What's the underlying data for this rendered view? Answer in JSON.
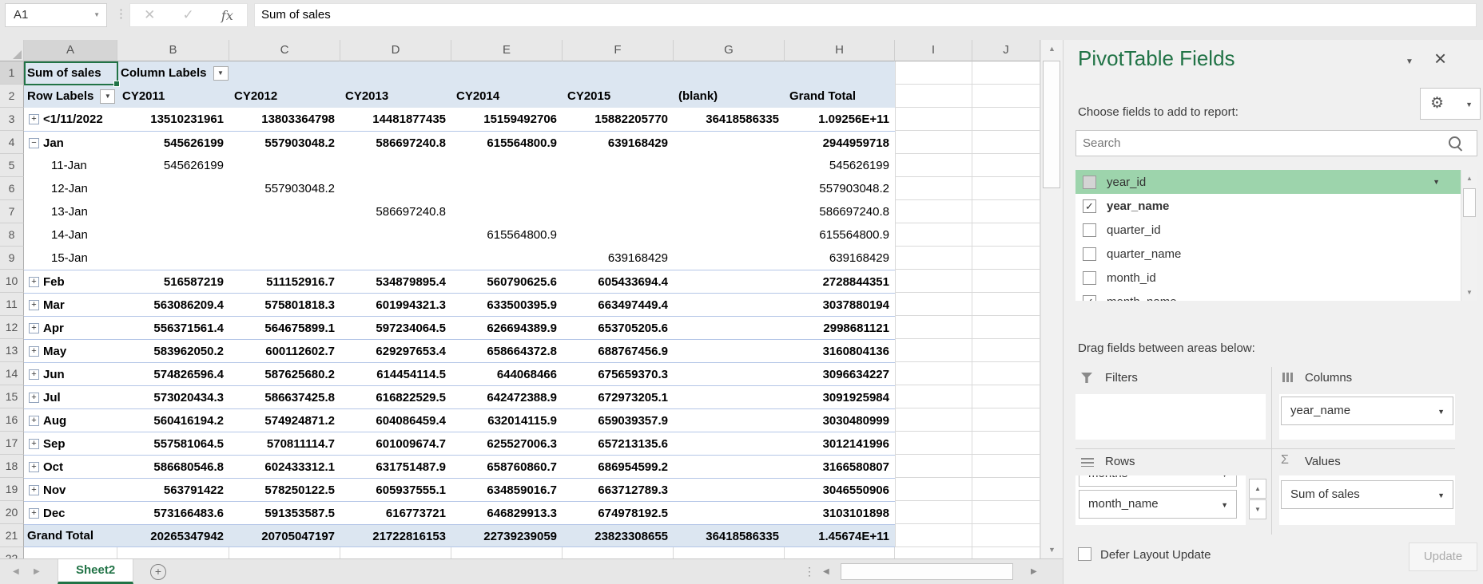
{
  "formula_bar": {
    "name_box": "A1",
    "formula": "Sum of sales"
  },
  "icons": {
    "dd": "▼",
    "caret": "▼",
    "up": "▲",
    "down": "▼",
    "left": "◀",
    "right": "▶",
    "check": "✓",
    "cancel": "✕",
    "enter": "✓",
    "fx": "fx",
    "dots": "⋮",
    "gear": "⚙",
    "sigma": "Σ",
    "close": "×",
    "plus": "+"
  },
  "grid": {
    "column_headers": [
      "A",
      "B",
      "C",
      "D",
      "E",
      "F",
      "G",
      "H",
      "I",
      "J"
    ],
    "pivot": {
      "row1": {
        "a": "Sum of sales",
        "b": "Column Labels"
      },
      "row2": {
        "a": "Row Labels",
        "headers": [
          "CY2011",
          "CY2012",
          "CY2013",
          "CY2014",
          "CY2015",
          "(blank)",
          "Grand Total"
        ]
      },
      "rows": [
        {
          "n": 3,
          "label": "<1/11/2022",
          "expand": "+",
          "bold": true,
          "sep": false,
          "v": [
            "13510231961",
            "13803364798",
            "14481877435",
            "15159492706",
            "15882205770",
            "36418586335",
            "1.09256E+11"
          ]
        },
        {
          "n": 4,
          "label": "Jan",
          "expand": "-",
          "bold": true,
          "sep": true,
          "v": [
            "545626199",
            "557903048.2",
            "586697240.8",
            "615564800.9",
            "639168429",
            "",
            "2944959718"
          ]
        },
        {
          "n": 5,
          "label": "11-Jan",
          "indent": true,
          "v": [
            "545626199",
            "",
            "",
            "",
            "",
            "",
            "545626199"
          ]
        },
        {
          "n": 6,
          "label": "12-Jan",
          "indent": true,
          "v": [
            "",
            "557903048.2",
            "",
            "",
            "",
            "",
            "557903048.2"
          ]
        },
        {
          "n": 7,
          "label": "13-Jan",
          "indent": true,
          "v": [
            "",
            "",
            "586697240.8",
            "",
            "",
            "",
            "586697240.8"
          ]
        },
        {
          "n": 8,
          "label": "14-Jan",
          "indent": true,
          "v": [
            "",
            "",
            "",
            "615564800.9",
            "",
            "",
            "615564800.9"
          ]
        },
        {
          "n": 9,
          "label": "15-Jan",
          "indent": true,
          "v": [
            "",
            "",
            "",
            "",
            "639168429",
            "",
            "639168429"
          ]
        },
        {
          "n": 10,
          "label": "Feb",
          "expand": "+",
          "bold": true,
          "sep": true,
          "v": [
            "516587219",
            "511152916.7",
            "534879895.4",
            "560790625.6",
            "605433694.4",
            "",
            "2728844351"
          ]
        },
        {
          "n": 11,
          "label": "Mar",
          "expand": "+",
          "bold": true,
          "sep": true,
          "v": [
            "563086209.4",
            "575801818.3",
            "601994321.3",
            "633500395.9",
            "663497449.4",
            "",
            "3037880194"
          ]
        },
        {
          "n": 12,
          "label": "Apr",
          "expand": "+",
          "bold": true,
          "sep": true,
          "v": [
            "556371561.4",
            "564675899.1",
            "597234064.5",
            "626694389.9",
            "653705205.6",
            "",
            "2998681121"
          ]
        },
        {
          "n": 13,
          "label": "May",
          "expand": "+",
          "bold": true,
          "sep": true,
          "v": [
            "583962050.2",
            "600112602.7",
            "629297653.4",
            "658664372.8",
            "688767456.9",
            "",
            "3160804136"
          ]
        },
        {
          "n": 14,
          "label": "Jun",
          "expand": "+",
          "bold": true,
          "sep": true,
          "v": [
            "574826596.4",
            "587625680.2",
            "614454114.5",
            "644068466",
            "675659370.3",
            "",
            "3096634227"
          ]
        },
        {
          "n": 15,
          "label": "Jul",
          "expand": "+",
          "bold": true,
          "sep": true,
          "v": [
            "573020434.3",
            "586637425.8",
            "616822529.5",
            "642472388.9",
            "672973205.1",
            "",
            "3091925984"
          ]
        },
        {
          "n": 16,
          "label": "Aug",
          "expand": "+",
          "bold": true,
          "sep": true,
          "v": [
            "560416194.2",
            "574924871.2",
            "604086459.4",
            "632014115.9",
            "659039357.9",
            "",
            "3030480999"
          ]
        },
        {
          "n": 17,
          "label": "Sep",
          "expand": "+",
          "bold": true,
          "sep": true,
          "v": [
            "557581064.5",
            "570811114.7",
            "601009674.7",
            "625527006.3",
            "657213135.6",
            "",
            "3012141996"
          ]
        },
        {
          "n": 18,
          "label": "Oct",
          "expand": "+",
          "bold": true,
          "sep": true,
          "v": [
            "586680546.8",
            "602433312.1",
            "631751487.9",
            "658760860.7",
            "686954599.2",
            "",
            "3166580807"
          ]
        },
        {
          "n": 19,
          "label": "Nov",
          "expand": "+",
          "bold": true,
          "sep": true,
          "v": [
            "563791422",
            "578250122.5",
            "605937555.1",
            "634859016.7",
            "663712789.3",
            "",
            "3046550906"
          ]
        },
        {
          "n": 20,
          "label": "Dec",
          "expand": "+",
          "bold": true,
          "sep": true,
          "v": [
            "573166483.6",
            "591353587.5",
            "616773721",
            "646829913.3",
            "674978192.5",
            "",
            "3103101898"
          ]
        },
        {
          "n": 21,
          "label": "Grand Total",
          "bold": true,
          "sep": true,
          "total": true,
          "v": [
            "20265347942",
            "20705047197",
            "21722816153",
            "22739239059",
            "23823308655",
            "36418586335",
            "1.45674E+11"
          ]
        }
      ]
    }
  },
  "sheet_tabs": {
    "active": "Sheet2"
  },
  "panel": {
    "title": "PivotTable Fields",
    "subtitle": "Choose fields to add to report:",
    "search_placeholder": "Search",
    "fields": [
      {
        "name": "year_id",
        "checked": false,
        "highlighted": true,
        "disabled_checkbox": true,
        "dropdown": true
      },
      {
        "name": "year_name",
        "checked": true,
        "bold": true
      },
      {
        "name": "quarter_id",
        "checked": false
      },
      {
        "name": "quarter_name",
        "checked": false
      },
      {
        "name": "month_id",
        "checked": false
      },
      {
        "name": "month_name",
        "checked": true
      }
    ],
    "drag_label": "Drag fields between areas below:",
    "areas": {
      "filters": {
        "label": "Filters",
        "items": []
      },
      "columns": {
        "label": "Columns",
        "items": [
          {
            "label": "year_name"
          }
        ]
      },
      "rows": {
        "label": "Rows",
        "items": [
          {
            "label": "months",
            "partial": true
          },
          {
            "label": "month_name"
          }
        ]
      },
      "values": {
        "label": "Values",
        "items": [
          {
            "label": "Sum of sales"
          }
        ]
      }
    },
    "defer_label": "Defer Layout Update",
    "update_label": "Update"
  },
  "colors": {
    "accent_green": "#217346",
    "pivot_header_bg": "#dce6f1",
    "pivot_border": "#b4c6e7",
    "field_highlight": "#9dd4ac"
  }
}
